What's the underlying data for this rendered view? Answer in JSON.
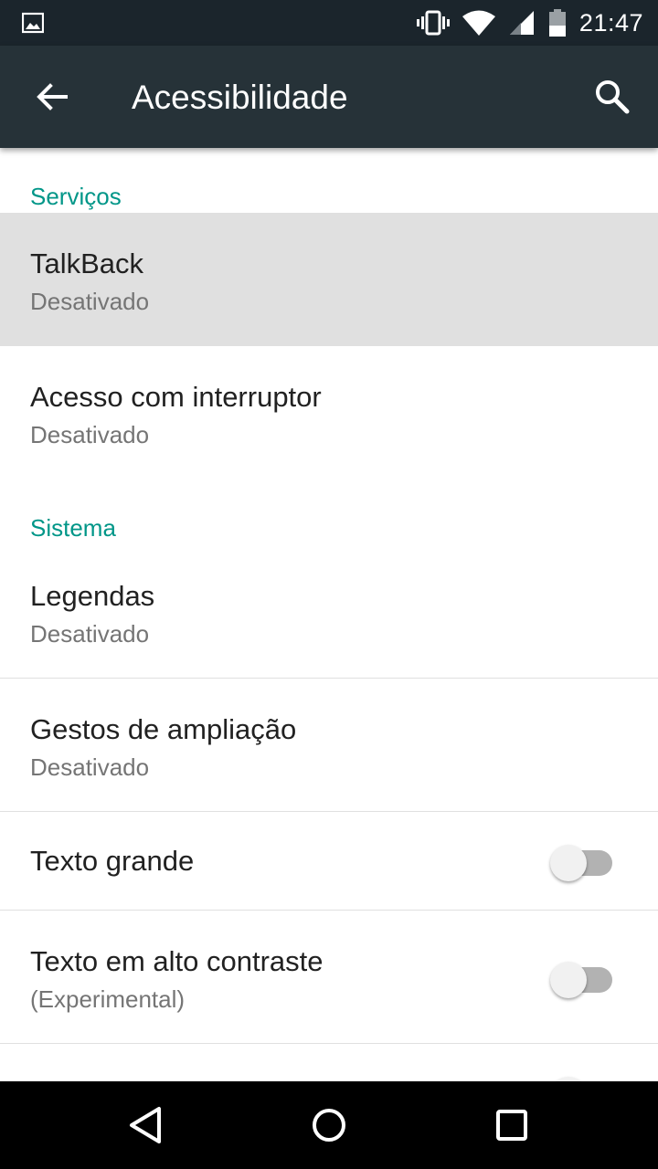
{
  "status_bar": {
    "time": "21:47",
    "icons": [
      "image-icon",
      "vibrate-icon",
      "wifi-icon",
      "signal-icon",
      "battery-icon"
    ]
  },
  "app_bar": {
    "title": "Acessibilidade",
    "icons": [
      "back-arrow-icon",
      "search-icon"
    ]
  },
  "sections": {
    "services_header": "Serviços",
    "system_header": "Sistema"
  },
  "items": {
    "talkback": {
      "title": "TalkBack",
      "summary": "Desativado"
    },
    "switch_access": {
      "title": "Acesso com interruptor",
      "summary": "Desativado"
    },
    "captions": {
      "title": "Legendas",
      "summary": "Desativado"
    },
    "magnification": {
      "title": "Gestos de ampliação",
      "summary": "Desativado"
    },
    "large_text": {
      "title": "Texto grande",
      "enabled": false
    },
    "high_contrast": {
      "title": "Texto em alto contraste",
      "summary": "(Experimental)",
      "enabled": false
    }
  },
  "nav_bar": {
    "icons": [
      "back-triangle-icon",
      "home-circle-icon",
      "recents-square-icon"
    ]
  },
  "colors": {
    "status_bar": "#1b252c",
    "app_bar": "#263238",
    "accent": "#009688",
    "pressed_row": "#e0e0e0"
  }
}
